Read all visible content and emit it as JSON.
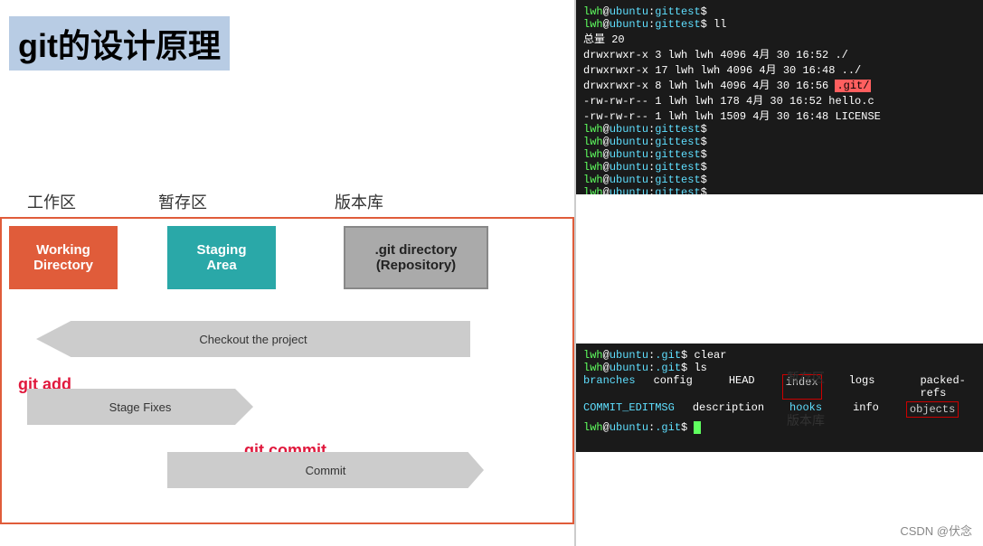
{
  "title": "git的设计原理",
  "zone_labels": {
    "work": "工作区",
    "stage": "暂存区",
    "repo": "版本库"
  },
  "boxes": {
    "working": "Working\nDirectory",
    "staging": "Staging\nArea",
    "git": ".git directory\n(Repository)"
  },
  "arrows": {
    "checkout": "Checkout the project",
    "stage_fixes": "Stage Fixes",
    "commit": "Commit"
  },
  "labels": {
    "git_add": "git add",
    "git_commit": "git commit"
  },
  "terminal_top": {
    "line1": "lwh@ubuntu:gittest$",
    "line2": "lwh@ubuntu:gittest$ ll",
    "line3": "总量 20",
    "line4": "drwxrwxr-x  3 lwh lwh 4096 4月  30 16:52 ./",
    "line5": "drwxrwxr-x 17 lwh lwh 4096 4月  30 16:48 ../",
    "line6_pre": "drwxrwxr-x  8 lwh lwh 4096 4月  30 16:56 ",
    "line6_highlight": ".git/",
    "line7": "-rw-rw-r--  1 lwh lwh  178 4月  30 16:52 hello.c",
    "line8": "-rw-rw-r--  1 lwh lwh 1509 4月  30 16:48 LICENSE",
    "prompts": [
      "lwh@ubuntu:gittest$",
      "lwh@ubuntu:gittest$",
      "lwh@ubuntu:gittest$",
      "lwh@ubuntu:gittest$",
      "lwh@ubuntu:gittest$",
      "lwh@ubuntu:gittest$"
    ]
  },
  "terminal_bottom": {
    "line1": "lwh@ubuntu:.git$ clear",
    "line2": "lwh@ubuntu:.git$ ls",
    "cols": {
      "col1": [
        "branches",
        "COMMIT_EDITMSG",
        "lwh@ubuntu:.git$"
      ],
      "col2": [
        "config",
        "description"
      ],
      "col3": [
        "HEAD",
        "hooks"
      ],
      "col4_label": "index",
      "col5": [
        "logs",
        "info"
      ],
      "col6": [
        "packed-refs",
        "refs"
      ],
      "col7_label": "objects"
    }
  },
  "annotations": {
    "staging": "暂存区",
    "repo": "版本库"
  },
  "watermark": "CSDN @伏念"
}
